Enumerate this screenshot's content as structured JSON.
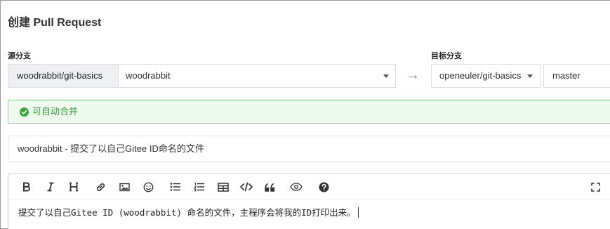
{
  "page": {
    "title": "创建 Pull Request"
  },
  "source": {
    "label": "源分支",
    "repo": "woodrabbit/git-basics",
    "branch": "woodrabbit"
  },
  "arrow": "→",
  "target": {
    "label": "目标分支",
    "repo": "openeuler/git-basics",
    "branch": "master"
  },
  "merge_status": {
    "text": "可自动合并",
    "color": "#3a9a3a"
  },
  "pr_title": {
    "value": "woodrabbit - 提交了以自己Gitee ID命名的文件"
  },
  "editor": {
    "toolbar": [
      {
        "icon": "bold-icon"
      },
      {
        "icon": "italic-icon"
      },
      {
        "icon": "heading-icon"
      },
      {
        "icon": "link-icon"
      },
      {
        "icon": "image-icon"
      },
      {
        "icon": "emoji-icon"
      },
      {
        "icon": "bullet-list-icon"
      },
      {
        "icon": "ordered-list-icon"
      },
      {
        "icon": "table-icon"
      },
      {
        "icon": "code-icon"
      },
      {
        "icon": "quote-icon"
      },
      {
        "icon": "preview-icon"
      },
      {
        "icon": "help-icon"
      },
      {
        "icon": "fullscreen-icon"
      }
    ],
    "content": "提交了以自己Gitee ID (woodrabbit) 命名的文件，主程序会将我的ID打印出来。"
  }
}
